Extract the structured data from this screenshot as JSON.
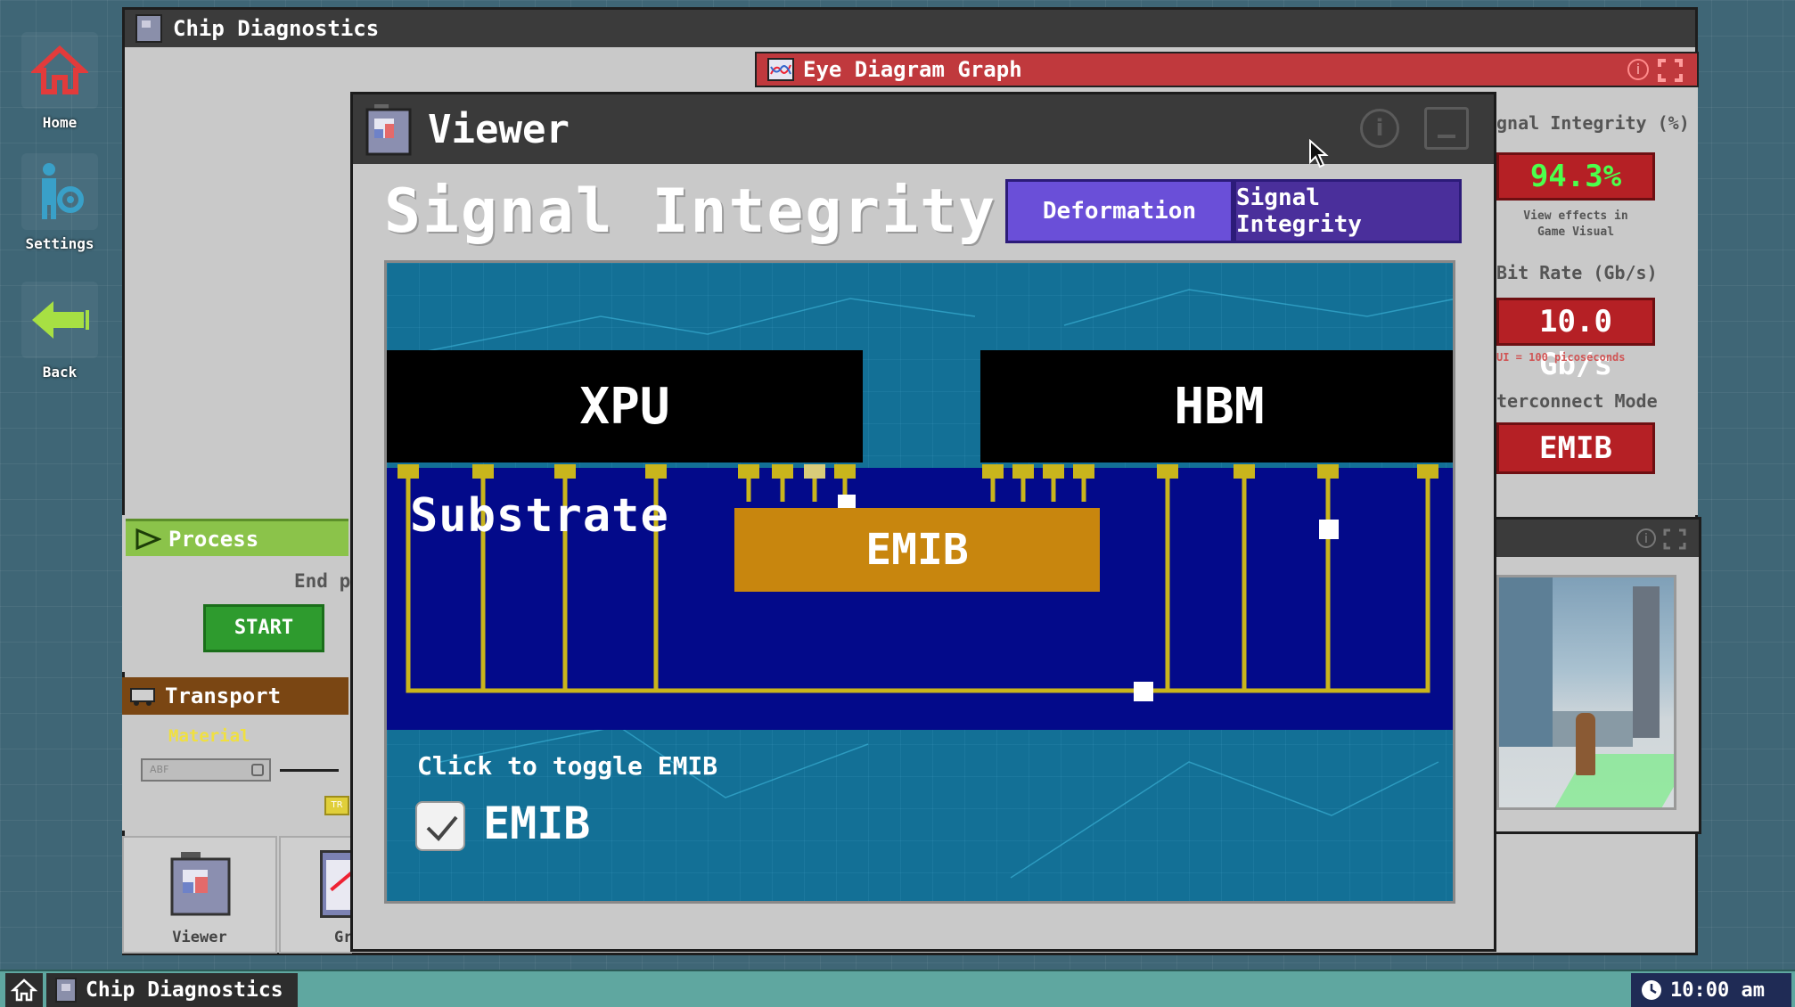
{
  "desktop": {
    "icons": [
      {
        "label": "Home",
        "icon": "home-icon"
      },
      {
        "label": "Settings",
        "icon": "settings-icon"
      },
      {
        "label": "Back",
        "icon": "back-arrow-icon"
      }
    ]
  },
  "main_window": {
    "title": "Chip Diagnostics"
  },
  "eye_window": {
    "title": "Eye Diagram Graph"
  },
  "metrics": {
    "signal_integrity_label": "gnal Integrity (%)",
    "signal_integrity_value": "94.3%",
    "view_effects_note_line1": "View effects in",
    "view_effects_note_line2": "Game Visual",
    "bit_rate_label": "Bit Rate (Gb/s)",
    "bit_rate_value": "10.0 Gb/s",
    "ui_note": "UI = 100 picoseconds",
    "interconnect_label": "terconnect Mode",
    "interconnect_value": "EMIB"
  },
  "process": {
    "header": "Process",
    "end_text": "End p",
    "start_button": "START"
  },
  "transport": {
    "header": "Transport",
    "material_label": "Material",
    "material_value": "ABF",
    "mini_button": "TR"
  },
  "dock": {
    "viewer_label": "Viewer",
    "graph_label": "Gr"
  },
  "viewer": {
    "title": "Viewer",
    "heading": "Signal Integrity",
    "tabs": {
      "deformation": "Deformation",
      "signal_integrity": "Signal Integrity"
    },
    "diagram": {
      "xpu_label": "XPU",
      "hbm_label": "HBM",
      "substrate_label": "Substrate",
      "emib_label": "EMIB",
      "toggle_hint": "Click to toggle EMIB",
      "checkbox_label": "EMIB",
      "checkbox_checked": true
    }
  },
  "taskbar": {
    "app_label": "Chip Diagnostics",
    "clock": "10:00 am"
  },
  "colors": {
    "accent_red": "#b52025",
    "integrity_green": "#4cff4c",
    "tab_purple": "#6a4fd8",
    "tab_purple_dark": "#4a2f9b",
    "substrate_blue": "#030a8a",
    "emib_gold": "#c8860e",
    "trace_gold": "#c9b51c",
    "process_green": "#8bc34a",
    "transport_brown": "#7a4613"
  }
}
